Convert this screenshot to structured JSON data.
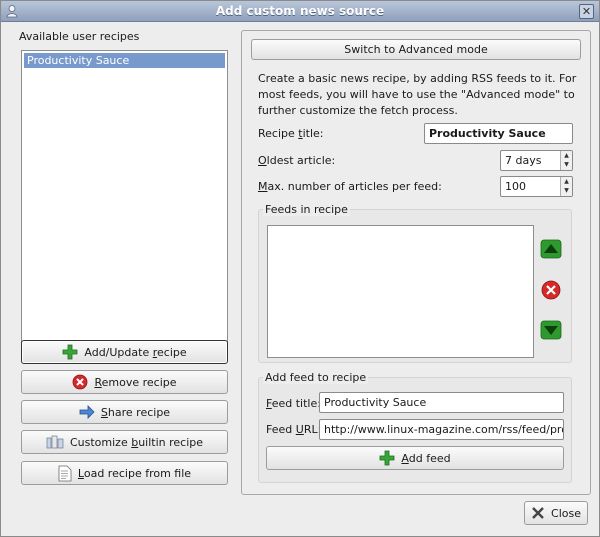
{
  "window": {
    "title": "Add custom news source",
    "close_glyph": "✕"
  },
  "left": {
    "heading": "Available user recipes",
    "recipes": [
      "Productivity Sauce"
    ],
    "buttons": {
      "add_update": {
        "pre": "Add/Update ",
        "u": "r",
        "post": "ecipe"
      },
      "remove": {
        "pre": "",
        "u": "R",
        "post": "emove recipe"
      },
      "share": {
        "pre": "",
        "u": "S",
        "post": "hare recipe"
      },
      "customize": {
        "pre": "Customize ",
        "u": "b",
        "post": "uiltin recipe"
      },
      "load": {
        "pre": "",
        "u": "L",
        "post": "oad recipe from file"
      }
    }
  },
  "right": {
    "advanced_button": "Switch to Advanced mode",
    "intro": "Create a basic news recipe, by adding RSS feeds to it. For most feeds, you will have to use the \"Advanced mode\" to further customize the fetch process.",
    "recipe_title": {
      "pre": "Recipe ",
      "u": "t",
      "post": "itle:",
      "value": "Productivity Sauce"
    },
    "oldest_article": {
      "pre": "",
      "u": "O",
      "post": "ldest article:",
      "value": "7 days"
    },
    "max_articles": {
      "pre": "",
      "u": "M",
      "post": "ax. number of articles per feed:",
      "value": "100"
    },
    "feeds_heading": "Feeds in recipe",
    "add_feed_heading": "Add feed to recipe",
    "feed_title": {
      "pre": "",
      "u": "F",
      "post": "eed title:",
      "value": "Productivity Sauce"
    },
    "feed_url": {
      "pre": "Feed ",
      "u": "U",
      "post": "RL:",
      "value": "http://www.linux-magazine.com/rss/feed/producti"
    },
    "add_feed_button": {
      "pre": "",
      "u": "A",
      "post": "dd feed"
    }
  },
  "footer": {
    "close": "Close"
  },
  "colors": {
    "accent_selection": "#7799cc",
    "titlebar": "#8fa0bb",
    "green": "#2e9a2e",
    "red": "#d42a2a"
  }
}
